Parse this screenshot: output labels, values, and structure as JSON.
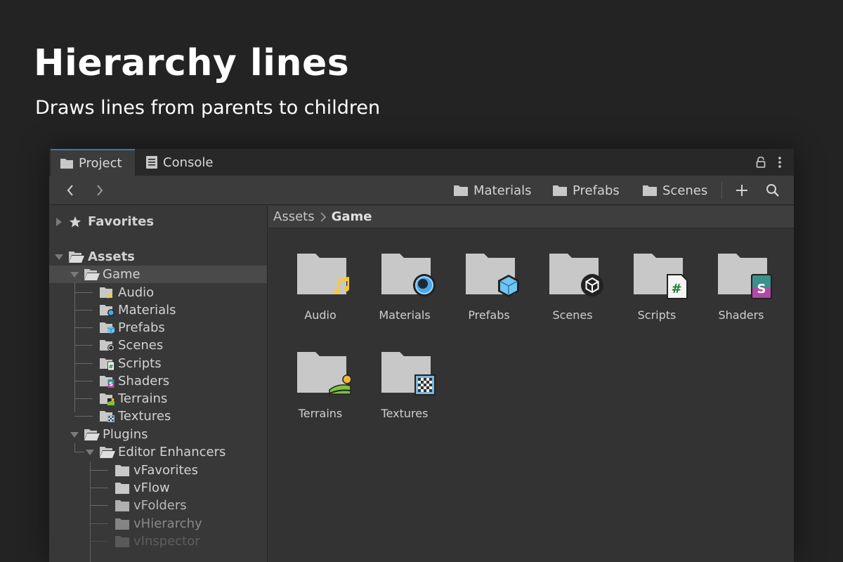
{
  "hero": {
    "title": "Hierarchy lines",
    "subtitle": "Draws lines from parents to children"
  },
  "tabs": [
    {
      "label": "Project",
      "icon": "folder-icon",
      "active": true
    },
    {
      "label": "Console",
      "icon": "console-icon",
      "active": false
    }
  ],
  "window_controls": [
    "lock-icon",
    "more-options-icon"
  ],
  "toolbar": {
    "back_icon": "chevron-left-icon",
    "forward_icon": "chevron-right-icon",
    "favorite_links": [
      "Materials",
      "Prefabs",
      "Scenes"
    ],
    "add_icon": "plus-icon",
    "search_icon": "search-icon"
  },
  "tree": {
    "favorites": "Favorites",
    "assets": "Assets",
    "game": "Game",
    "game_children": [
      "Audio",
      "Materials",
      "Prefabs",
      "Scenes",
      "Scripts",
      "Shaders",
      "Terrains",
      "Textures"
    ],
    "plugins": "Plugins",
    "editor_enhancers": "Editor Enhancers",
    "enhancer_children": [
      "vFavorites",
      "vFlow",
      "vFolders",
      "vHierarchy",
      "vInspector"
    ]
  },
  "breadcrumb": {
    "root": "Assets",
    "current": "Game"
  },
  "grid": {
    "items": [
      {
        "label": "Audio",
        "badge": "music-note-icon"
      },
      {
        "label": "Materials",
        "badge": "material-sphere-icon"
      },
      {
        "label": "Prefabs",
        "badge": "prefab-cube-icon"
      },
      {
        "label": "Scenes",
        "badge": "unity-scene-icon"
      },
      {
        "label": "Scripts",
        "badge": "csharp-script-icon"
      },
      {
        "label": "Shaders",
        "badge": "shader-icon"
      },
      {
        "label": "Terrains",
        "badge": "terrain-icon"
      },
      {
        "label": "Textures",
        "badge": "texture-checker-icon"
      }
    ]
  },
  "colors": {
    "background": "#232323",
    "panel": "#383838",
    "accent": "#3a79bb",
    "folder": "#c8c8c8"
  }
}
